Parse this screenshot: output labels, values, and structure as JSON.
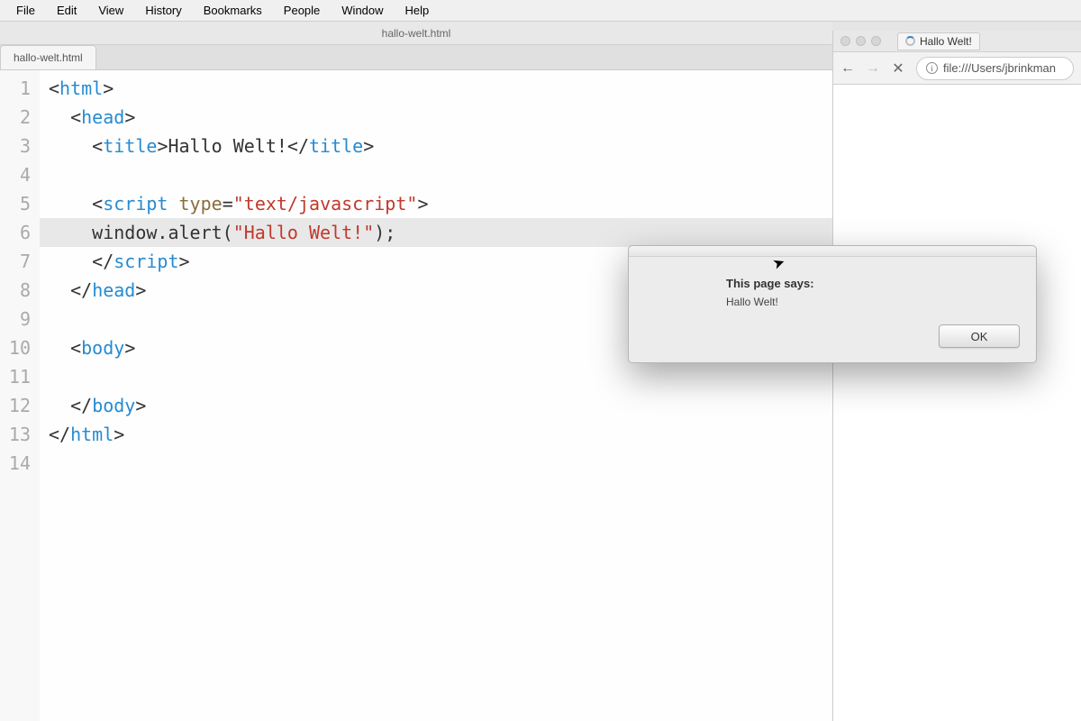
{
  "menubar": {
    "items": [
      "File",
      "Edit",
      "View",
      "History",
      "Bookmarks",
      "People",
      "Window",
      "Help"
    ]
  },
  "editor": {
    "title": "hallo-welt.html",
    "tab": "hallo-welt.html",
    "gutter": [
      "1",
      "2",
      "3",
      "4",
      "5",
      "6",
      "7",
      "8",
      "9",
      "10",
      "11",
      "12",
      "13",
      "14"
    ],
    "code": {
      "l1": {
        "ind": 0,
        "open": "<",
        "tag": "html",
        "close": ">"
      },
      "l2": {
        "ind": 1,
        "open": "<",
        "tag": "head",
        "close": ">"
      },
      "l3": {
        "ind": 2,
        "open": "<",
        "tag": "title",
        "mid": ">Hallo Welt!</",
        "tagc": "title",
        "close": ">"
      },
      "l4": {
        "ind": 0,
        "blank": " "
      },
      "l5": {
        "ind": 2,
        "open": "<",
        "tag": "script",
        "sp": " ",
        "attr": "type",
        "eq": "=",
        "str": "\"text/javascript\"",
        "close": ">"
      },
      "l6": {
        "ind": 2,
        "code_a": "window.alert(",
        "str": "\"Hallo Welt!\"",
        "code_b": ");"
      },
      "l7": {
        "ind": 2,
        "open": "</",
        "tag": "script",
        "close": ">"
      },
      "l8": {
        "ind": 1,
        "open": "</",
        "tag": "head",
        "close": ">"
      },
      "l9": {
        "ind": 0,
        "blank": " "
      },
      "l10": {
        "ind": 1,
        "open": "<",
        "tag": "body",
        "close": ">"
      },
      "l11": {
        "ind": 0,
        "blank": " "
      },
      "l12": {
        "ind": 1,
        "open": "</",
        "tag": "body",
        "close": ">"
      },
      "l13": {
        "ind": 0,
        "open": "</",
        "tag": "html",
        "close": ">"
      },
      "l14": {
        "ind": 0,
        "blank": " "
      }
    }
  },
  "browser": {
    "tab_title": "Hallo Welt!",
    "url": "file:///Users/jbrinkman"
  },
  "alert": {
    "title": "This page says:",
    "message": "Hallo Welt!",
    "ok": "OK"
  }
}
